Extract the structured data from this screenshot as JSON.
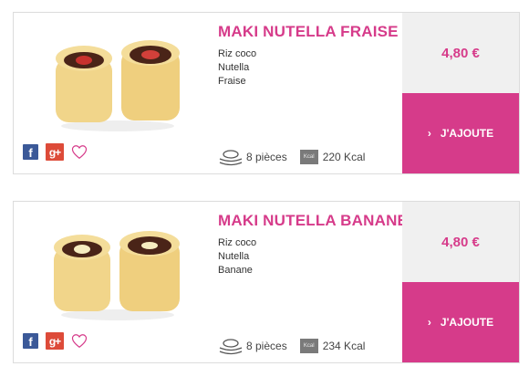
{
  "products": [
    {
      "title": "MAKI NUTELLA FRAISE",
      "ingredients": [
        "Riz coco",
        "Nutella",
        "Fraise"
      ],
      "pieces": "8 pièces",
      "kcal_badge": "Kcal",
      "kcal": "220 Kcal",
      "price": "4,80 €",
      "add_label": "J'AJOUTE",
      "social": {
        "facebook": "f",
        "google_plus": "g+"
      }
    },
    {
      "title": "MAKI NUTELLA BANANE",
      "ingredients": [
        "Riz coco",
        "Nutella",
        "Banane"
      ],
      "pieces": "8 pièces",
      "kcal_badge": "Kcal",
      "kcal": "234 Kcal",
      "price": "4,80 €",
      "add_label": "J'AJOUTE",
      "social": {
        "facebook": "f",
        "google_plus": "g+"
      }
    }
  ],
  "colors": {
    "accent": "#d63b8a",
    "price_bg": "#f0f0f0",
    "facebook": "#3b5998",
    "google_plus": "#dd4b39"
  },
  "icons": [
    "facebook-icon",
    "google-plus-icon",
    "heart-icon",
    "pieces-icon",
    "kcal-icon",
    "chevron-right-icon"
  ]
}
